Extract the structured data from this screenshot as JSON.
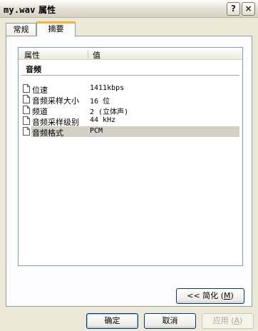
{
  "window": {
    "title_filename": "my.wav",
    "title_suffix": "属性",
    "help_label": "?",
    "close_label": "×"
  },
  "tabs": [
    {
      "label": "常规",
      "active": false
    },
    {
      "label": "摘要",
      "active": true
    }
  ],
  "list": {
    "columns": [
      "属性",
      "值"
    ],
    "group": "音频",
    "rows": [
      {
        "property": "位速",
        "value": "1411kbps"
      },
      {
        "property": "音频采样大小",
        "value": "16 位"
      },
      {
        "property": "频道",
        "value": "2 (立体声)"
      },
      {
        "property": "音频采样级别",
        "value": "44 kHz"
      },
      {
        "property": "音频格式",
        "value": "PCM",
        "selected": true
      }
    ]
  },
  "buttons": {
    "simple": {
      "prefix": "<< 简化",
      "accel_open": " (",
      "accel": "M",
      "accel_close": ")"
    },
    "ok": "确定",
    "cancel": "取消",
    "apply": {
      "label": "应用",
      "accel_open": " (",
      "accel": "A",
      "accel_close": ")"
    }
  },
  "icons": {
    "row_icon": "document-icon",
    "help": "help-icon",
    "close": "close-icon"
  }
}
